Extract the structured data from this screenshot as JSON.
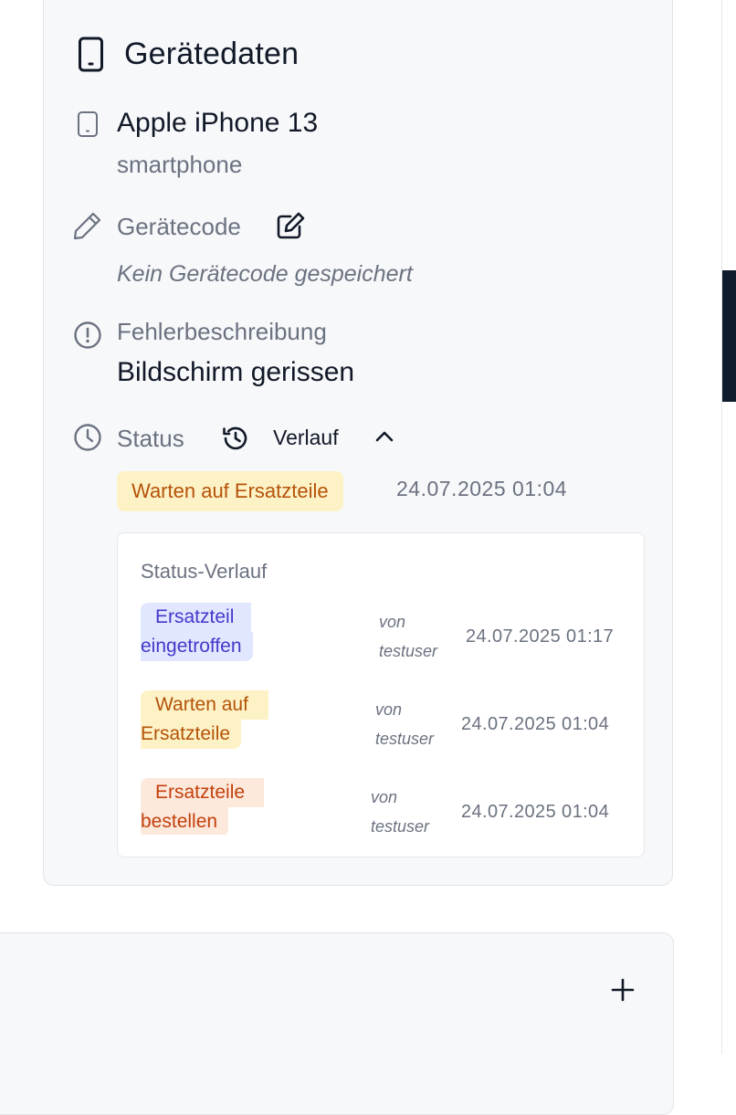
{
  "device_card": {
    "title": "Gerätedaten",
    "device": {
      "name": "Apple iPhone 13",
      "type": "smartphone"
    },
    "device_code": {
      "label": "Gerätecode",
      "empty_text": "Kein Gerätecode gespeichert"
    },
    "fault": {
      "label": "Fehlerbeschreibung",
      "value": "Bildschirm gerissen"
    },
    "status": {
      "label": "Status",
      "history_toggle_label": "Verlauf",
      "current": {
        "label": "Warten auf Ersatzteile",
        "date": "24.07.2025 01:04"
      }
    },
    "history": {
      "title": "Status-Verlauf",
      "entries": [
        {
          "line1": "Ersatzteil",
          "line2": "eingetroffen",
          "by_prefix": "von",
          "by_user": "testuser",
          "date": "24.07.2025 01:17",
          "bg": "#e0e7ff",
          "fg": "#4338ca"
        },
        {
          "line1": "Warten auf",
          "line2": "Ersatzteile",
          "by_prefix": "von",
          "by_user": "testuser",
          "date": "24.07.2025 01:04",
          "bg": "#fdf2c6",
          "fg": "#b45309"
        },
        {
          "line1": "Ersatzteile",
          "line2": "bestellen",
          "by_prefix": "von",
          "by_user": "testuser",
          "date": "24.07.2025 01:04",
          "bg": "#fde8dc",
          "fg": "#c2410c"
        }
      ]
    }
  },
  "icons": [
    "smartphone-icon",
    "device-icon",
    "pencil-icon",
    "edit-square-icon",
    "alert-circle-icon",
    "clock-icon",
    "history-icon",
    "chevron-up-icon",
    "plus-icon"
  ],
  "colors": {
    "card_bg": "#f7f8fa",
    "muted_text": "#6b7280",
    "dark_panel": "#0f1b2d"
  }
}
